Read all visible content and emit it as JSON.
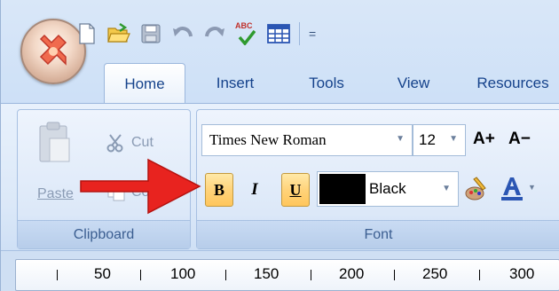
{
  "quick_access": {
    "icons": [
      "new-document-icon",
      "open-folder-icon",
      "save-icon",
      "undo-icon",
      "redo-icon",
      "spell-check-icon",
      "table-icon"
    ],
    "spellcheck_text": "ABC",
    "customize_glyph": "="
  },
  "tabs": [
    {
      "label": "Home",
      "active": true
    },
    {
      "label": "Insert",
      "active": false
    },
    {
      "label": "Tools",
      "active": false
    },
    {
      "label": "View",
      "active": false
    },
    {
      "label": "Resources",
      "active": false
    }
  ],
  "clipboard": {
    "cut_label": "Cut",
    "paste_label": "Paste",
    "copy_label": "Copy",
    "group_label": "Clipboard"
  },
  "font": {
    "family": "Times New Roman",
    "size": "12",
    "grow_label": "A+",
    "shrink_label": "A−",
    "bold_label": "B",
    "italic_label": "I",
    "underline_label": "U",
    "color_name": "Black",
    "color_value": "#000000",
    "group_label": "Font"
  },
  "ruler": {
    "numbers": [
      "50",
      "100",
      "150",
      "200",
      "250",
      "300"
    ]
  },
  "colors": {
    "accent_arrow": "#e8231f",
    "button_highlight": "#ffd37a"
  }
}
